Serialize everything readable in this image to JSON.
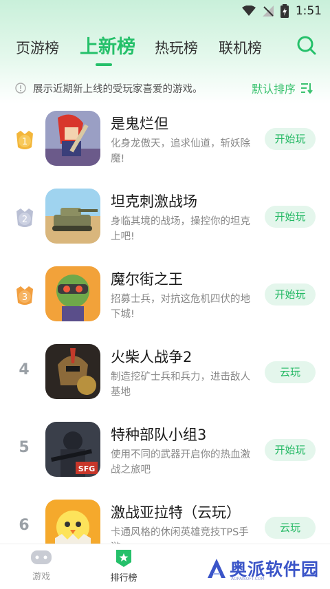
{
  "status_bar": {
    "time": "1:51"
  },
  "tabs": [
    {
      "label": "页游榜",
      "active": false
    },
    {
      "label": "上新榜",
      "active": true
    },
    {
      "label": "热玩榜",
      "active": false
    },
    {
      "label": "联机榜",
      "active": false
    }
  ],
  "notice": {
    "text": "展示近期新上线的受玩家喜爱的游戏。"
  },
  "sort": {
    "label": "默认排序"
  },
  "colors": {
    "accent": "#25c06a",
    "gold": "#f3b63a",
    "silver": "#b9bfd4",
    "bronze": "#f29f3f"
  },
  "games": [
    {
      "rank": "1",
      "medal": "gold",
      "title": "是鬼烂但",
      "desc": "化身龙傲天，追求仙道，斩妖除魔!",
      "button": "开始玩"
    },
    {
      "rank": "2",
      "medal": "silver",
      "title": "坦克刺激战场",
      "desc": "身临其境的战场，操控你的坦克上吧!",
      "button": "开始玩"
    },
    {
      "rank": "3",
      "medal": "bronze",
      "title": "魔尔街之王",
      "desc": "招募士兵，对抗这危机四伏的地下城!",
      "button": "开始玩"
    },
    {
      "rank": "4",
      "medal": "",
      "title": "火柴人战争2",
      "desc": "制造挖矿士兵和兵力，进击敌人基地",
      "button": "云玩"
    },
    {
      "rank": "5",
      "medal": "",
      "title": "特种部队小组3",
      "desc": "使用不同的武器开启你的热血激战之旅吧",
      "button": "开始玩"
    },
    {
      "rank": "6",
      "medal": "",
      "title": "激战亚拉特（云玩）",
      "desc": "卡通风格的休闲英雄竞技TPS手游",
      "button": "云玩"
    }
  ],
  "icon_badges": {
    "sfg": "SFG"
  },
  "bottom_nav": [
    {
      "label": "游戏",
      "active": false
    },
    {
      "label": "排行榜",
      "active": true
    }
  ],
  "watermark": {
    "text": "奥派软件园",
    "sub": "AOPAISOFT.COM"
  }
}
